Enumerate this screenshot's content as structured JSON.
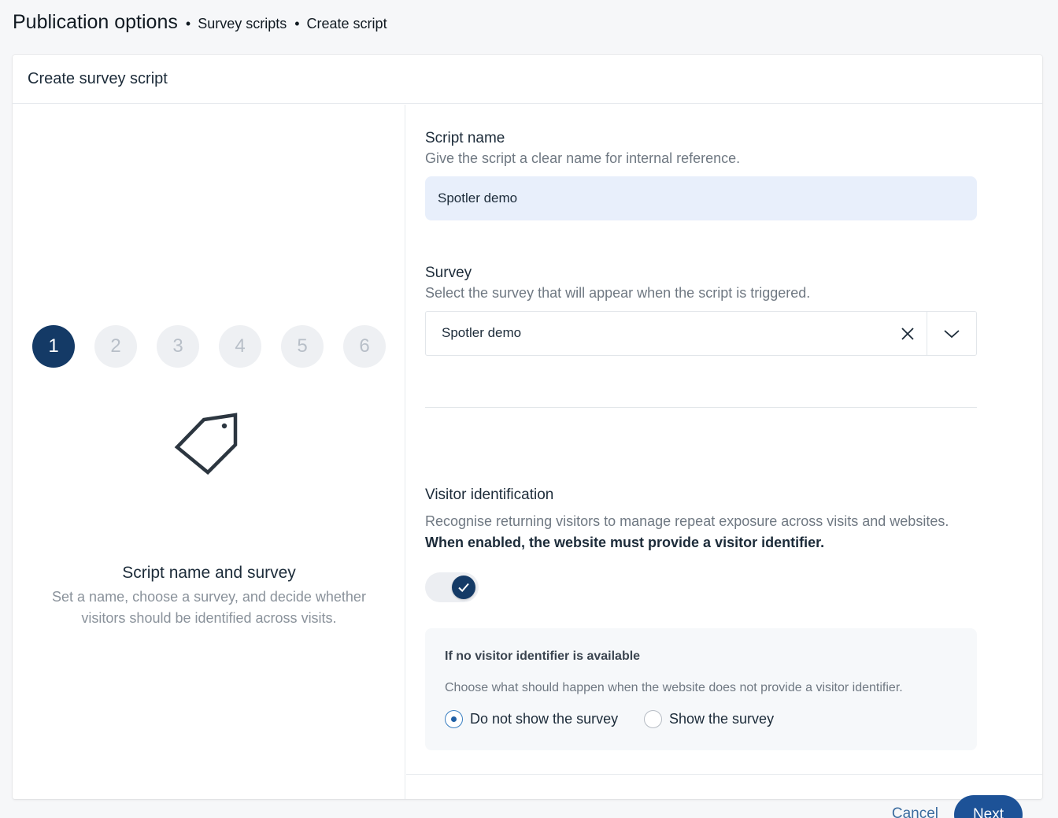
{
  "breadcrumb": {
    "title": "Publication options",
    "items": [
      "Survey scripts",
      "Create script"
    ]
  },
  "card": {
    "title": "Create survey script"
  },
  "stepper": {
    "steps": [
      "1",
      "2",
      "3",
      "4",
      "5",
      "6"
    ],
    "active_step": "1",
    "active_color": "#143a66",
    "icon": "tag-icon",
    "title": "Script name and survey",
    "description": "Set a name, choose a survey, and decide whether visitors should be identified across visits."
  },
  "script_name": {
    "label": "Script name",
    "help": "Give the script a clear name for internal reference.",
    "value": "Spotler demo"
  },
  "survey": {
    "label": "Survey",
    "help": "Select the survey that will appear when the script is triggered.",
    "selected": "Spotler demo",
    "clear_icon": "close-icon",
    "dropdown_icon": "chevron-down-icon"
  },
  "visitor_identification": {
    "label": "Visitor identification",
    "help": "Recognise returning visitors to manage repeat exposure across visits and websites.",
    "note": "When enabled, the website must provide a visitor identifier.",
    "enabled": true,
    "toggle_icon": "check-icon"
  },
  "fallback": {
    "title": "If no visitor identifier is available",
    "description": "Choose what should happen when the website does not provide a visitor identifier.",
    "options": [
      "Do not show the survey",
      "Show the survey"
    ],
    "selected": "Do not show the survey"
  },
  "actions": {
    "cancel_label": "Cancel",
    "next_label": "Next",
    "primary_color": "#1d5297"
  }
}
